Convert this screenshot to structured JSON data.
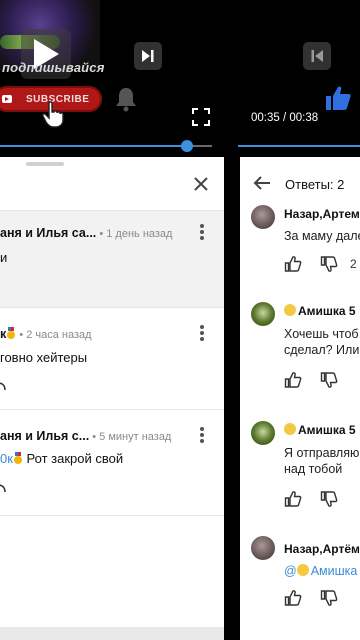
{
  "left_video": {
    "overlay_text": "подпишывайся",
    "subscribe_label": "SUBSCRIBE",
    "progress_fraction": 0.88
  },
  "left_comments": [
    {
      "header": "аня и  Илья са...",
      "time": " • 1 день назад",
      "text": "и",
      "highlight": true
    },
    {
      "header": "к",
      "time": " • 2 часа назад",
      "text": "говно хейтеры",
      "highlight": false
    },
    {
      "header": "аня и  Илья с...",
      "time": " • 5 минут назад",
      "mention": "0к",
      "text": " Рот закрой свой",
      "highlight": false
    }
  ],
  "right_panel": {
    "time_label": "00:35 / 00:38",
    "replies_title": "Ответы: 2",
    "replies": [
      {
        "name": "Назар,Артем",
        "text": [
          "За маму дале"
        ],
        "like_count": "2"
      },
      {
        "name": "Амишка 5",
        "text": [
          "Хочешь чтоб",
          "сделал? Или"
        ],
        "like_count": ""
      },
      {
        "name": "Амишка 5",
        "text": [
          "Я отправляю",
          "над тобой"
        ],
        "like_count": ""
      },
      {
        "name": "Назар,Артём",
        "mention": "@",
        "mention_name": "Амишка",
        "like_count": ""
      }
    ]
  },
  "colors": {
    "accent_blue": "#3d8fe0",
    "subscribe_red": "#b01717"
  }
}
